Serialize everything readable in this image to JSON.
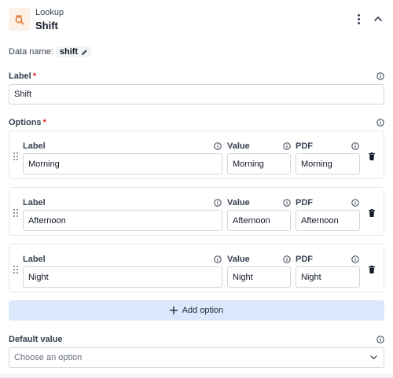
{
  "header": {
    "type_label": "Lookup",
    "title": "Shift",
    "icon": "lookup-icon",
    "accent_color": "#e8793a",
    "icon_bg_color": "#fdf0e6"
  },
  "data_name": {
    "label": "Data name:",
    "value": "shift"
  },
  "label_field": {
    "label": "Label",
    "required_mark": "*",
    "value": "Shift"
  },
  "options_section": {
    "label": "Options",
    "required_mark": "*",
    "column_labels": {
      "label": "Label",
      "value": "Value",
      "pdf": "PDF"
    },
    "items": [
      {
        "label": "Morning",
        "value": "Morning",
        "pdf": "Morning"
      },
      {
        "label": "Afternoon",
        "value": "Afternoon",
        "pdf": "Afternoon"
      },
      {
        "label": "Night",
        "value": "Night",
        "pdf": "Night"
      }
    ]
  },
  "add_option": {
    "label": "Add option",
    "bg_color": "#dbe8fb"
  },
  "default_value": {
    "label": "Default value",
    "placeholder": "Choose an option"
  }
}
